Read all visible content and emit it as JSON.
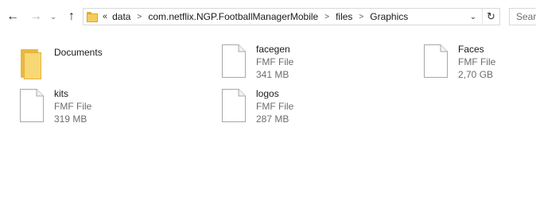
{
  "nav": {
    "back_glyph": "←",
    "forward_glyph": "→",
    "recent_glyph": "⌄",
    "up_glyph": "↑"
  },
  "address": {
    "overflow_glyph": "«",
    "crumbs": [
      "data",
      "com.netflix.NGP.FootballManagerMobile",
      "files",
      "Graphics"
    ],
    "dropdown_glyph": "⌄",
    "refresh_glyph": "↻"
  },
  "search": {
    "text": "Searc"
  },
  "items": [
    {
      "name": "Documents",
      "type": "",
      "size": "",
      "kind": "folder-icon"
    },
    {
      "name": "facegen",
      "type": "FMF File",
      "size": "341 MB",
      "kind": "file-icon"
    },
    {
      "name": "Faces",
      "type": "FMF File",
      "size": "2,70 GB",
      "kind": "file-icon"
    },
    {
      "name": "kits",
      "type": "FMF File",
      "size": "319 MB",
      "kind": "file-icon"
    },
    {
      "name": "logos",
      "type": "FMF File",
      "size": "287 MB",
      "kind": "file-icon"
    }
  ],
  "colors": {
    "folder_yellow": "#f8d775",
    "secondary_text": "#6d6d6d"
  }
}
